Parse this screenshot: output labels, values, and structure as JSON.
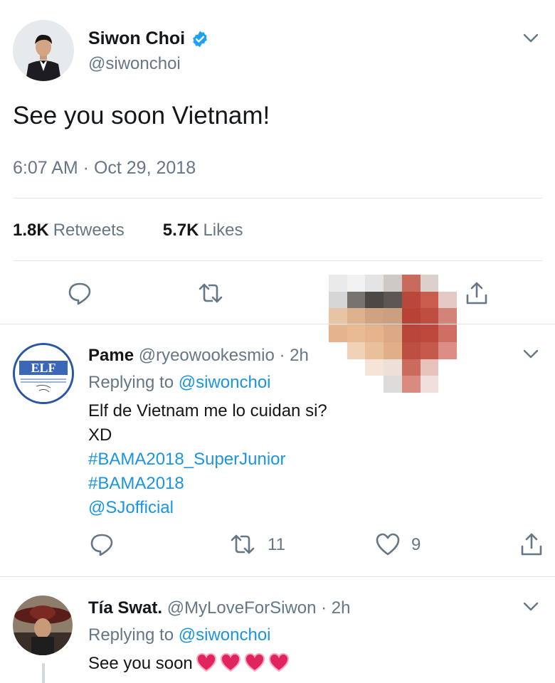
{
  "main_tweet": {
    "author_name": "Siwon Choi",
    "author_handle": "@siwonchoi",
    "text": "See you soon Vietnam!",
    "timestamp": "6:07 AM · Oct 29, 2018",
    "retweets_count": "1.8K",
    "retweets_label": "Retweets",
    "likes_count": "5.7K",
    "likes_label": "Likes"
  },
  "replies": [
    {
      "name": "Pame",
      "handle": "@ryeowookesmio",
      "time": "· 2h",
      "replying_prefix": "Replying to",
      "replying_to": "@siwonchoi",
      "lines": [
        "Elf de Vietnam me lo cuidan si?",
        "XD"
      ],
      "links": [
        "#BAMA2018_SuperJunior",
        "#BAMA2018",
        "@SJofficial"
      ],
      "retweet_count": "11",
      "like_count": "9",
      "avatar_text": "ELF"
    },
    {
      "name": "Tía Swat.",
      "handle": "@MyLoveForSiwon",
      "time": "· 2h",
      "replying_prefix": "Replying to",
      "replying_to": "@siwonchoi",
      "text": "See you soon"
    }
  ],
  "icons": {
    "reply": "reply-icon",
    "retweet": "retweet-icon",
    "like": "heart-icon",
    "share": "share-icon",
    "more": "chevron-down-icon",
    "verified": "verified-badge-icon"
  },
  "colors": {
    "link": "#1b95e0",
    "secondary_text": "#657786",
    "primary_text": "#14171a",
    "verified": "#1da1f2",
    "heart_emoji": "#e0245e"
  }
}
